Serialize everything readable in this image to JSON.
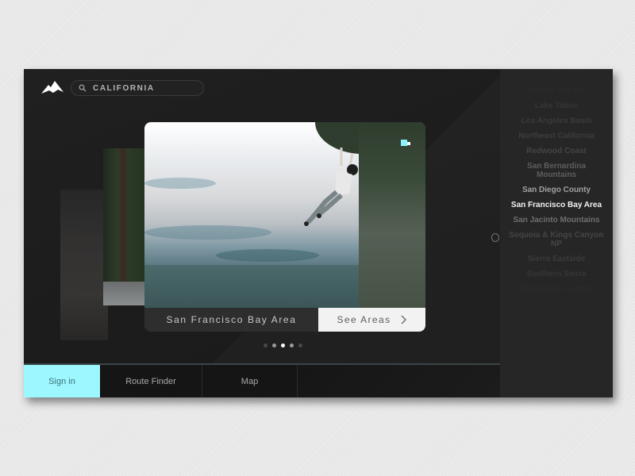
{
  "header": {
    "logo": "mountain-logo",
    "search": {
      "value": "CALIFORNIA",
      "icon": "search-icon"
    }
  },
  "featured": {
    "title": "San Francisco Bay Area",
    "cta_label": "See Areas",
    "cta_icon": "chevron-right-icon",
    "carousel": {
      "total": 5,
      "active_index": 2
    }
  },
  "regions": {
    "items": [
      "Jeoaret Tree NP",
      "Lake Tahoe",
      "Los Angeles Basin",
      "Northeast California",
      "Redwood Coast",
      "San Bernardina Mountains",
      "San Diego County",
      "San Francisco Bay Area",
      "San Jacinto Mountains",
      "Sequoia & Kings Canyon NP",
      "Sierra Eastside",
      "Southern Sierra",
      "Tehachapi & Southern"
    ],
    "selected_index": 7
  },
  "nav": {
    "items": [
      {
        "label": "Sign in",
        "active": true
      },
      {
        "label": "Route Finder",
        "active": false
      },
      {
        "label": "Map",
        "active": false
      }
    ]
  },
  "colors": {
    "accent": "#9cf7ff",
    "background": "#1f1f1f",
    "sidebar": "#262626"
  }
}
